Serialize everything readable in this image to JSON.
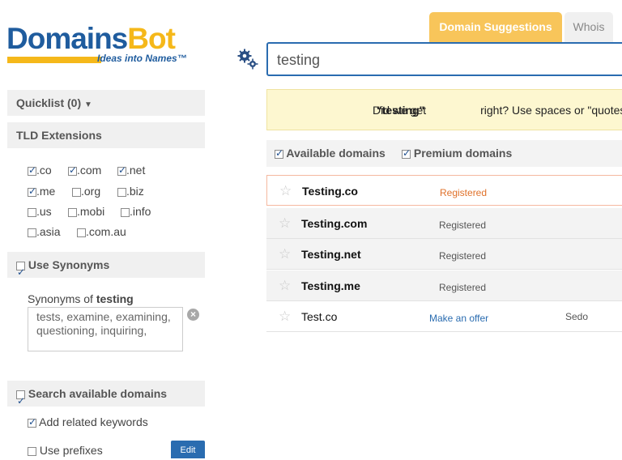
{
  "logo": {
    "word1": "Domains",
    "word2": "Bot",
    "tagline": "Ideas into Names™"
  },
  "tabs": [
    {
      "label": "Domain Suggestions",
      "active": true
    },
    {
      "label": "Whois",
      "active": false
    }
  ],
  "search": {
    "value": "testing"
  },
  "notice": {
    "before": "Did we get ",
    "term": "\"testing\"",
    "after": " right? Use spaces or \"quotes\" to sepa"
  },
  "filters": [
    {
      "label": "Available domains",
      "checked": true
    },
    {
      "label": "Premium domains",
      "checked": true
    }
  ],
  "results": [
    {
      "name": "Testing.co",
      "status": "Registered",
      "seller": ""
    },
    {
      "name": "Testing.com",
      "status": "Registered",
      "seller": ""
    },
    {
      "name": "Testing.net",
      "status": "Registered",
      "seller": ""
    },
    {
      "name": "Testing.me",
      "status": "Registered",
      "seller": ""
    },
    {
      "name": "Test.co",
      "status": "Make an offer",
      "seller": "Sedo"
    }
  ],
  "sidebar": {
    "quicklist": "Quicklist (0)",
    "quicklist_arrow": "▼",
    "tld_title": "TLD Extensions",
    "tlds": [
      {
        "label": ".co",
        "checked": true
      },
      {
        "label": ".com",
        "checked": true
      },
      {
        "label": ".net",
        "checked": true
      },
      {
        "label": ".me",
        "checked": true
      },
      {
        "label": ".org",
        "checked": false
      },
      {
        "label": ".biz",
        "checked": false
      },
      {
        "label": ".us",
        "checked": false
      },
      {
        "label": ".mobi",
        "checked": false
      },
      {
        "label": ".info",
        "checked": false
      },
      {
        "label": ".asia",
        "checked": false
      },
      {
        "label": ".com.au",
        "checked": false
      }
    ],
    "synonyms_title": "Use Synonyms",
    "synonyms_label": "Synonyms of ",
    "synonyms_term": "testing",
    "synonyms_text": "tests, examine, examining, questioning, inquiring,",
    "search_available_title": "Search available domains",
    "add_related": "Add related keywords",
    "use_prefixes": "Use prefixes",
    "edit_label": "Edit"
  }
}
